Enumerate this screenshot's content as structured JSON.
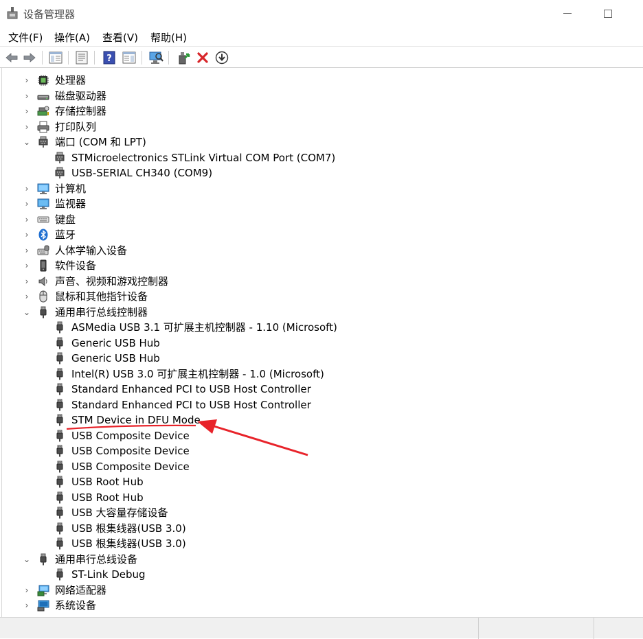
{
  "window": {
    "title": "设备管理器"
  },
  "menu": [
    "文件(F)",
    "操作(A)",
    "查看(V)",
    "帮助(H)"
  ],
  "toolbar": [
    {
      "name": "back-arrow-icon"
    },
    {
      "name": "forward-arrow-icon"
    },
    {
      "name": "show-hide-console-tree-icon"
    },
    {
      "name": "properties-icon"
    },
    {
      "name": "help-icon"
    },
    {
      "name": "action-pane-icon"
    },
    {
      "name": "scan-hardware-icon"
    },
    {
      "name": "update-driver-icon"
    },
    {
      "name": "uninstall-device-icon"
    },
    {
      "name": "download-icon"
    }
  ],
  "tree": [
    {
      "label": "处理器",
      "icon": "cpu-icon",
      "level": 0,
      "expanded": false
    },
    {
      "label": "磁盘驱动器",
      "icon": "disk-drive-icon",
      "level": 0,
      "expanded": false
    },
    {
      "label": "存储控制器",
      "icon": "storage-controller-icon",
      "level": 0,
      "expanded": false
    },
    {
      "label": "打印队列",
      "icon": "printer-icon",
      "level": 0,
      "expanded": false
    },
    {
      "label": "端口 (COM 和 LPT)",
      "icon": "port-icon",
      "level": 0,
      "expanded": true
    },
    {
      "label": "STMicroelectronics STLink Virtual COM Port (COM7)",
      "icon": "port-icon",
      "level": 1
    },
    {
      "label": "USB-SERIAL CH340 (COM9)",
      "icon": "port-icon",
      "level": 1
    },
    {
      "label": "计算机",
      "icon": "computer-icon",
      "level": 0,
      "expanded": false
    },
    {
      "label": "监视器",
      "icon": "monitor-icon",
      "level": 0,
      "expanded": false
    },
    {
      "label": "键盘",
      "icon": "keyboard-icon",
      "level": 0,
      "expanded": false
    },
    {
      "label": "蓝牙",
      "icon": "bluetooth-icon",
      "level": 0,
      "expanded": false
    },
    {
      "label": "人体学输入设备",
      "icon": "hid-icon",
      "level": 0,
      "expanded": false
    },
    {
      "label": "软件设备",
      "icon": "software-device-icon",
      "level": 0,
      "expanded": false
    },
    {
      "label": "声音、视频和游戏控制器",
      "icon": "speaker-icon",
      "level": 0,
      "expanded": false
    },
    {
      "label": "鼠标和其他指针设备",
      "icon": "mouse-icon",
      "level": 0,
      "expanded": false
    },
    {
      "label": "通用串行总线控制器",
      "icon": "usb-plug-icon",
      "level": 0,
      "expanded": true
    },
    {
      "label": "ASMedia USB 3.1 可扩展主机控制器 - 1.10 (Microsoft)",
      "icon": "usb-plug-icon",
      "level": 1
    },
    {
      "label": "Generic USB Hub",
      "icon": "usb-plug-icon",
      "level": 1
    },
    {
      "label": "Generic USB Hub",
      "icon": "usb-plug-icon",
      "level": 1
    },
    {
      "label": "Intel(R) USB 3.0 可扩展主机控制器 - 1.0 (Microsoft)",
      "icon": "usb-plug-icon",
      "level": 1
    },
    {
      "label": "Standard Enhanced PCI to USB Host Controller",
      "icon": "usb-plug-icon",
      "level": 1
    },
    {
      "label": "Standard Enhanced PCI to USB Host Controller",
      "icon": "usb-plug-icon",
      "level": 1
    },
    {
      "label": "STM Device in DFU Mode",
      "icon": "usb-plug-icon",
      "level": 1,
      "highlighted": true
    },
    {
      "label": "USB Composite Device",
      "icon": "usb-plug-icon",
      "level": 1
    },
    {
      "label": "USB Composite Device",
      "icon": "usb-plug-icon",
      "level": 1
    },
    {
      "label": "USB Composite Device",
      "icon": "usb-plug-icon",
      "level": 1
    },
    {
      "label": "USB Root Hub",
      "icon": "usb-plug-icon",
      "level": 1
    },
    {
      "label": "USB Root Hub",
      "icon": "usb-plug-icon",
      "level": 1
    },
    {
      "label": "USB 大容量存储设备",
      "icon": "usb-plug-icon",
      "level": 1
    },
    {
      "label": "USB 根集线器(USB 3.0)",
      "icon": "usb-plug-icon",
      "level": 1
    },
    {
      "label": "USB 根集线器(USB 3.0)",
      "icon": "usb-plug-icon",
      "level": 1
    },
    {
      "label": "通用串行总线设备",
      "icon": "usb-plug-icon",
      "level": 0,
      "expanded": true
    },
    {
      "label": "ST-Link Debug",
      "icon": "usb-plug-icon",
      "level": 1
    },
    {
      "label": "网络适配器",
      "icon": "network-adapter-icon",
      "level": 0,
      "expanded": false
    },
    {
      "label": "系统设备",
      "icon": "system-device-icon",
      "level": 0,
      "expanded": false
    }
  ],
  "colors": {
    "annotation": "#e8232a"
  }
}
